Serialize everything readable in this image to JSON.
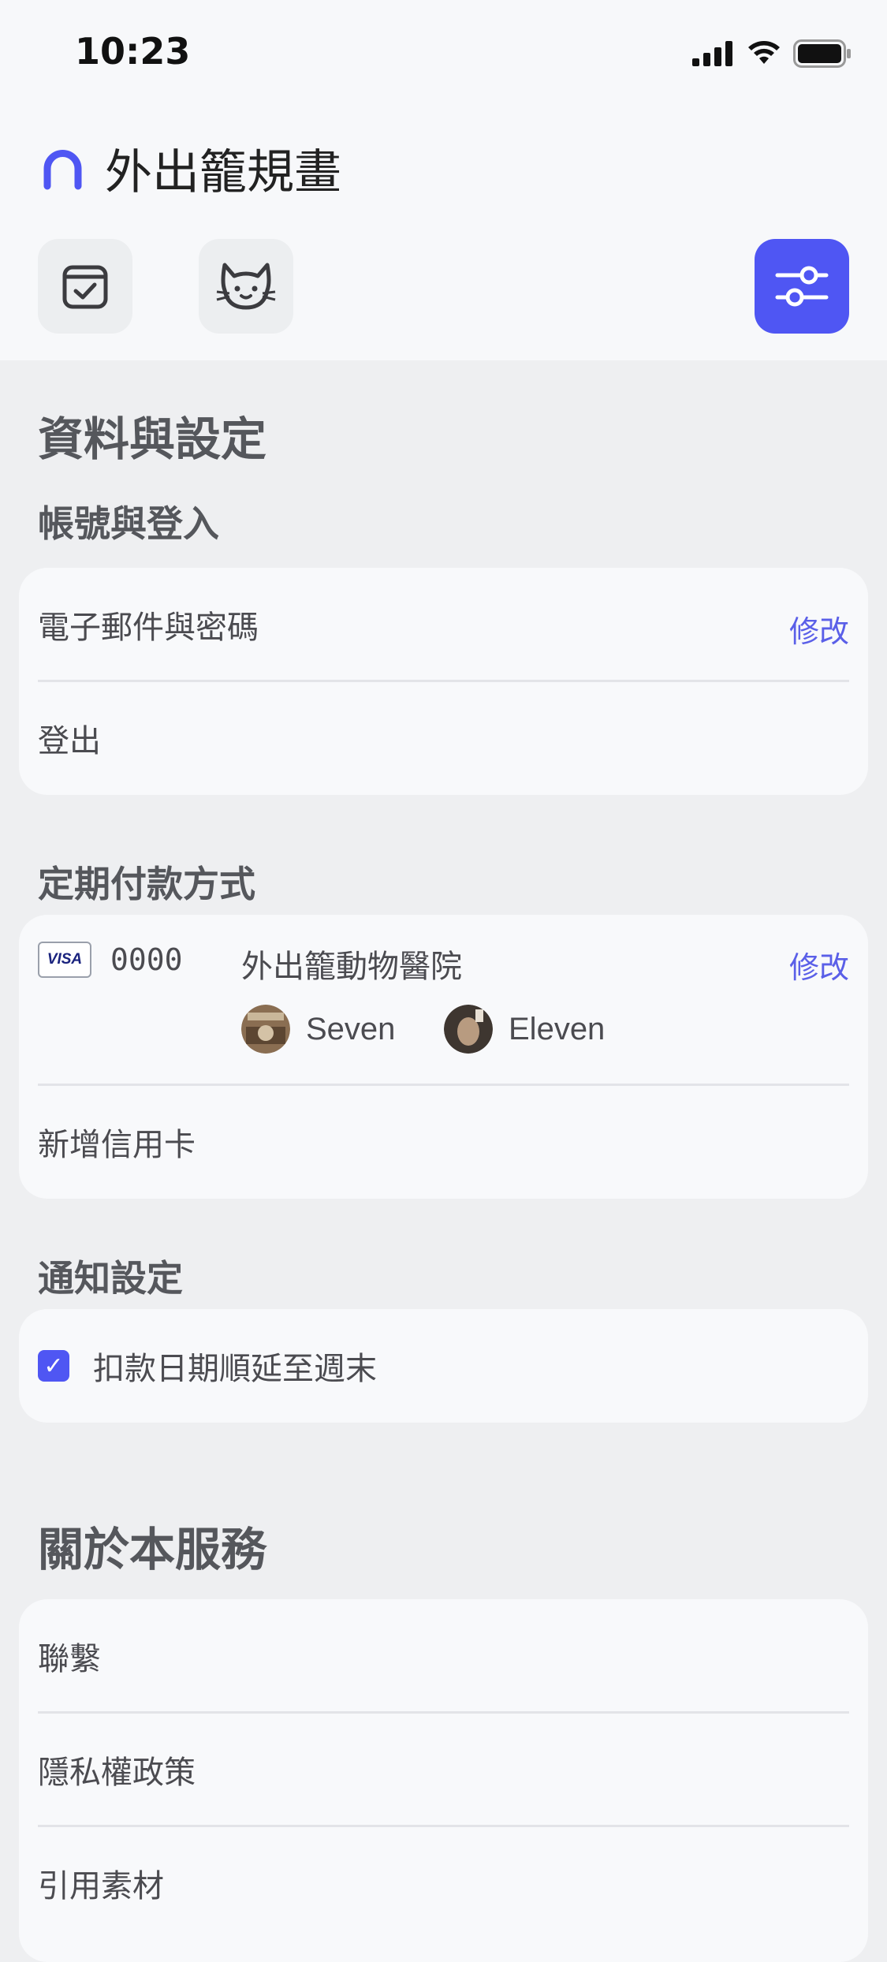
{
  "status_bar": {
    "time": "10:23"
  },
  "header": {
    "title": "外出籠規畫"
  },
  "sections": {
    "settings_title": "資料與設定",
    "about_title": "關於本服務"
  },
  "account": {
    "title": "帳號與登入",
    "email_label": "電子郵件與密碼",
    "email_edit": "修改",
    "logout_label": "登出"
  },
  "payment": {
    "title": "定期付款方式",
    "card_brand": "VISA",
    "card_last4": "0000",
    "payee": "外出籠動物醫院",
    "edit": "修改",
    "pets": [
      "Seven",
      "Eleven"
    ],
    "add_card": "新增信用卡"
  },
  "notification": {
    "title": "通知設定",
    "option_label": "扣款日期順延至週末",
    "option_checked": true
  },
  "about": {
    "contact": "聯繫",
    "privacy": "隱私權政策",
    "credits": "引用素材"
  },
  "colors": {
    "accent": "#4f56f3",
    "link": "#5a5fe8",
    "background": "#eeeff1"
  }
}
